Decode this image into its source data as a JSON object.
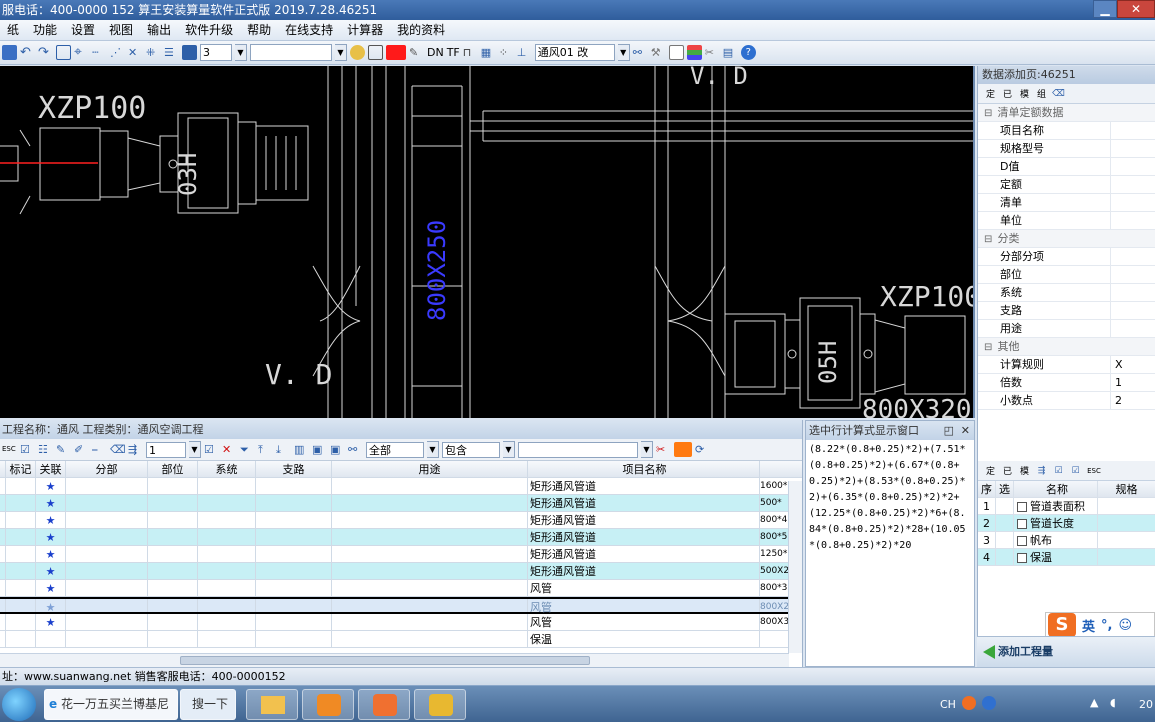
{
  "window": {
    "title": "服电话：400-0000 152    算王安装算量软件正式版 2019.7.28.46251"
  },
  "menu": [
    "纸",
    "功能",
    "设置",
    "视图",
    "输出",
    "软件升级",
    "帮助",
    "在线支持",
    "计算器",
    "我的资料"
  ],
  "toolbar": {
    "layer_value": "3",
    "layer_input": "",
    "system_value": "通风01 改",
    "labels": {
      "dn": "DN",
      "tf": "TF"
    }
  },
  "cad": {
    "labels": {
      "xzp_left": "XZP100",
      "xzp_right": "XZP100",
      "duct_size": "800X250",
      "duct_size_bottom": "800X320",
      "v_d_left": "V. D",
      "v_d_top": "V. D",
      "h03": "03H",
      "h05": "05H"
    }
  },
  "property_panel": {
    "title": "数据添加页:46251",
    "tools": [
      "定",
      "已",
      "模",
      "组",
      "选"
    ],
    "groups": [
      {
        "name": "清单定额数据",
        "rows": [
          {
            "key": "项目名称",
            "value": ""
          },
          {
            "key": "规格型号",
            "value": ""
          },
          {
            "key": "D值",
            "value": ""
          },
          {
            "key": "定额",
            "value": ""
          },
          {
            "key": "清单",
            "value": ""
          },
          {
            "key": "单位",
            "value": ""
          }
        ]
      },
      {
        "name": "分类",
        "rows": [
          {
            "key": "分部分项",
            "value": ""
          },
          {
            "key": "部位",
            "value": ""
          },
          {
            "key": "系统",
            "value": ""
          },
          {
            "key": "支路",
            "value": ""
          },
          {
            "key": "用途",
            "value": ""
          }
        ]
      },
      {
        "name": "其他",
        "rows": [
          {
            "key": "计算规则",
            "value": "X"
          },
          {
            "key": "倍数",
            "value": "1"
          },
          {
            "key": "小数点",
            "value": "2"
          }
        ]
      }
    ]
  },
  "right_table": {
    "tools": [
      "定",
      "已",
      "模",
      "组",
      "选",
      "选",
      "ESC"
    ],
    "headers": [
      "序",
      "选",
      "名称",
      "规格"
    ],
    "rows": [
      {
        "no": "1",
        "name": "管道表面积"
      },
      {
        "no": "2",
        "name": "管道长度"
      },
      {
        "no": "3",
        "name": "帆布"
      },
      {
        "no": "4",
        "name": "保温"
      }
    ],
    "add_button": "添加工程量"
  },
  "ime": {
    "lang": "英"
  },
  "grid": {
    "title": "工程名称：通风  工程类别：通风空调工程",
    "filter_value": "1",
    "range_value": "全部",
    "match_value": "包含",
    "headers": [
      "标记",
      "关联",
      "分部",
      "部位",
      "系统",
      "支路",
      "用途",
      "项目名称"
    ],
    "rows": [
      {
        "star": "★",
        "name": "矩形通风管道",
        "spec": "1600*"
      },
      {
        "star": "★",
        "name": "矩形通风管道",
        "spec": "500*"
      },
      {
        "star": "★",
        "name": "矩形通风管道",
        "spec": "800*4"
      },
      {
        "star": "★",
        "name": "矩形通风管道",
        "spec": "800*5"
      },
      {
        "star": "★",
        "name": "矩形通风管道",
        "spec": "1250*"
      },
      {
        "star": "★",
        "name": "矩形通风管道",
        "spec": "500X2"
      },
      {
        "star": "★",
        "name": "风管",
        "spec": "800*3"
      },
      {
        "star": "★",
        "name": "风管",
        "spec": "800X2"
      },
      {
        "star": "★",
        "name": "风管",
        "spec": "800X3"
      },
      {
        "star": "",
        "name": "保温",
        "spec": ""
      }
    ]
  },
  "formula": {
    "title": "选中行计算式显示窗口",
    "text": "(8.22*(0.8+0.25)*2)+(7.51*(0.8+0.25)*2)+(6.67*(0.8+0.25)*2)+(8.53*(0.8+0.25)*2)+(6.35*(0.8+0.25)*2)*2+(12.25*(0.8+0.25)*2)*6+(8.84*(0.8+0.25)*2)*28+(10.05*(0.8+0.25)*2)*20"
  },
  "status": {
    "text": "址：www.suanwang.net 销售客服电话：400-0000152"
  },
  "taskbar": {
    "ie_label": "花一万五买兰博基尼",
    "search_label": "搜一下",
    "ime_indicator": "CH",
    "clock": "20"
  },
  "colors": {
    "duct_label": "#3a3aff",
    "red_line": "#ff2020",
    "cyan_row": "#c7f0f5",
    "star": "#1a3fcc"
  }
}
